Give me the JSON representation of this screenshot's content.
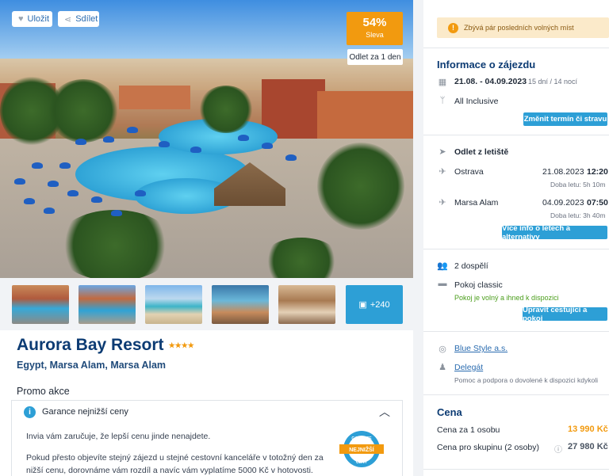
{
  "hero": {
    "like_label": "Uložit",
    "share_label": "Sdílet",
    "discount_pct": "54%",
    "discount_label": "Sleva",
    "departure_badge": "Odlet za 1 den"
  },
  "gallery": {
    "more_count": "+240"
  },
  "hotel": {
    "name": "Aurora Bay Resort",
    "stars": 4,
    "stars_text": "★★★★",
    "location": "Egypt, Marsa Alam, Marsa Alam"
  },
  "promo": {
    "title": "Promo akce",
    "guarantee_label": "Garance nejnižší ceny",
    "text1": "Invia vám zaručuje, že lepší cenu jinde nenajdete.",
    "text2a": "Pokud přesto objevíte stejný zájezd u stejné cestovní kanceláře v totožný den za",
    "text2b": "nižší cenu, dorovnáme vám rozdíl a navíc vám vyplatíme 5000 Kč v hotovosti.",
    "badge_top": "GARANCE",
    "badge_mid": "NEJNIŽŠÍ",
    "badge_bot": "CENY"
  },
  "sidebar": {
    "warning": "Zbývá pár posledních volných míst",
    "info_title": "Informace o zájezdu",
    "dates": "21.08. - 04.09.2023",
    "duration": "15 dní / 14 nocí",
    "board": "All Inclusive",
    "change_btn": "Změnit termín či stravu",
    "departure_title": "Odlet z letiště",
    "out_city": "Ostrava",
    "out_date": "21.08.2023",
    "out_time": "12:20",
    "out_duration": "Doba letu: 5h 10m",
    "back_city": "Marsa Alam",
    "back_date": "04.09.2023",
    "back_time": "07:50",
    "back_duration": "Doba letu: 3h 40m",
    "flights_btn": "Více info o letech a alternativy",
    "travelers": "2 dospělí",
    "room": "Pokoj classic",
    "room_status": "Pokoj je volný a ihned k dispozici",
    "edit_btn": "Upravit cestující a pokoj",
    "agency": "Blue Style a.s.",
    "delegate": "Delegát",
    "delegate_desc": "Pomoc a podpora o dovolené k dispozici kdykoli",
    "price_title": "Cena",
    "price_person_label": "Cena za 1 osobu",
    "price_person": "13 990 Kč",
    "price_group_label": "Cena pro skupinu (2 osoby)",
    "price_group": "27 980 Kč"
  },
  "colors": {
    "accent_blue": "#2d9fd6",
    "discount_orange": "#f29a0f",
    "navy": "#0c3b73",
    "price_orange": "#f29a0f",
    "status_green": "#4b9e1c"
  }
}
